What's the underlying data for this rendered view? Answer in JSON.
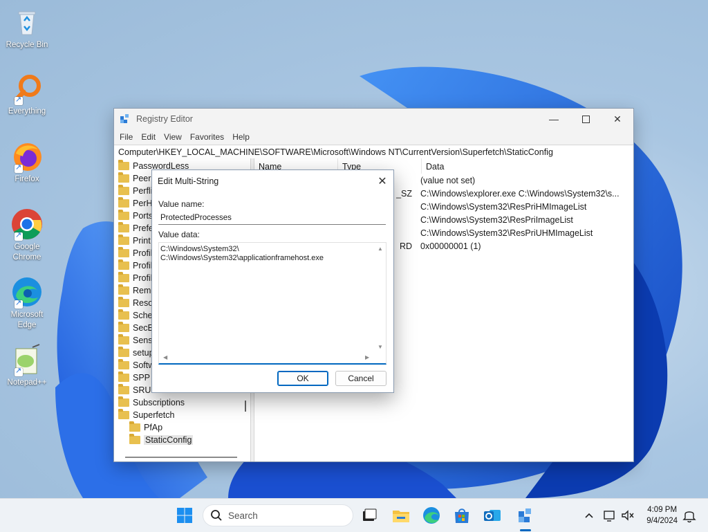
{
  "desktop": {
    "icons": [
      {
        "label": "Recycle Bin"
      },
      {
        "label": "Everything"
      },
      {
        "label": "Firefox"
      },
      {
        "label": "Google Chrome"
      },
      {
        "label": "Microsoft Edge"
      },
      {
        "label": "Notepad++"
      }
    ]
  },
  "regedit": {
    "title": "Registry Editor",
    "menu": [
      "File",
      "Edit",
      "View",
      "Favorites",
      "Help"
    ],
    "address": "Computer\\HKEY_LOCAL_MACHINE\\SOFTWARE\\Microsoft\\Windows NT\\CurrentVersion\\Superfetch\\StaticConfig",
    "tree": [
      "PasswordLess",
      "PeerDist",
      "PerfHost",
      "PerHwIdStorage",
      "Ports",
      "Prefetcher",
      "Print",
      "ProfileGuid",
      "ProfileList",
      "ProfileNotification",
      "RemoteRegistry",
      "ResourceManager",
      "Schedule",
      "SecEdit",
      "Sensor",
      "setup",
      "Software",
      "SPP",
      "SRUM",
      "Subscriptions",
      "Superfetch",
      "PfAp",
      "StaticConfig"
    ],
    "tree_visible": [
      "PasswordLess",
      "PeerD",
      "Perflit",
      "PerHv",
      "Ports",
      "Prefet",
      "Print",
      "Profile",
      "Profile",
      "Profile",
      "Remo",
      "Resou",
      "Schec",
      "SecEd",
      "Senso",
      "setup",
      "Softw",
      "SPP",
      "SRUM",
      "Subscriptions",
      "Superfetch",
      "PfAp",
      "StaticConfig"
    ],
    "list_headers": {
      "name": "Name",
      "type": "Type",
      "data": "Data"
    },
    "rows": [
      {
        "type": "",
        "data": "(value not set)"
      },
      {
        "type": "_SZ",
        "data": "C:\\Windows\\explorer.exe C:\\Windows\\System32\\s..."
      },
      {
        "type": "",
        "data": "C:\\Windows\\System32\\ResPriHMImageList"
      },
      {
        "type": "",
        "data": "C:\\Windows\\System32\\ResPriImageList"
      },
      {
        "type": "",
        "data": "C:\\Windows\\System32\\ResPriUHMImageList"
      },
      {
        "type": "RD",
        "data": "0x00000001 (1)"
      }
    ]
  },
  "dialog": {
    "title": "Edit Multi-String",
    "value_name_label": "Value name:",
    "value_name": "ProtectedProcesses",
    "value_data_label": "Value data:",
    "value_data": "C:\\Windows\\System32\\\nC:\\Windows\\System32\\applicationframehost.exe",
    "ok": "OK",
    "cancel": "Cancel"
  },
  "taskbar": {
    "search_placeholder": "Search",
    "time": "4:09 PM",
    "date": "9/4/2024"
  },
  "colors": {
    "accent": "#0067c0",
    "folder": "#e8c04f"
  }
}
